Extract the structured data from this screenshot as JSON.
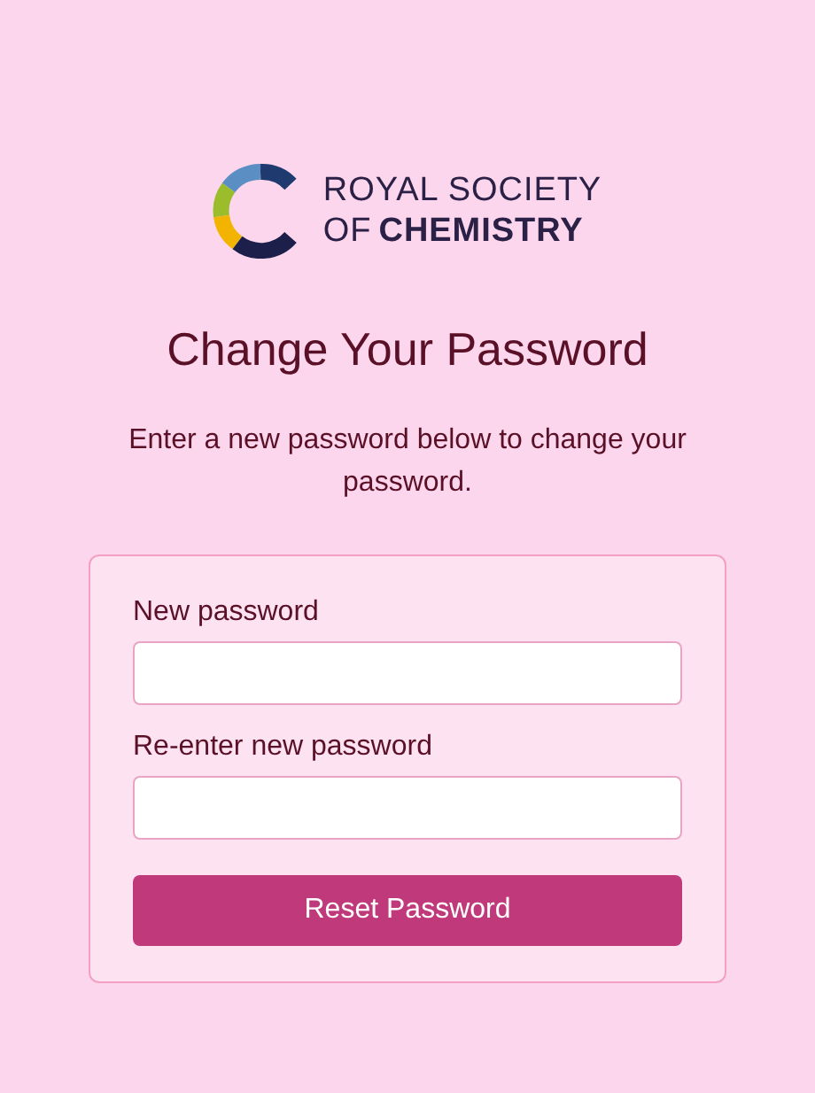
{
  "logo": {
    "line_1": "ROYAL SOCIETY",
    "line_2_prefix": "OF",
    "line_2": "CHEMISTRY"
  },
  "title": "Change Your Password",
  "description": "Enter a new password below to change your password.",
  "form": {
    "fields": [
      {
        "label": "New password"
      },
      {
        "label": "Re-enter new password"
      }
    ],
    "submit": "Reset Password"
  }
}
